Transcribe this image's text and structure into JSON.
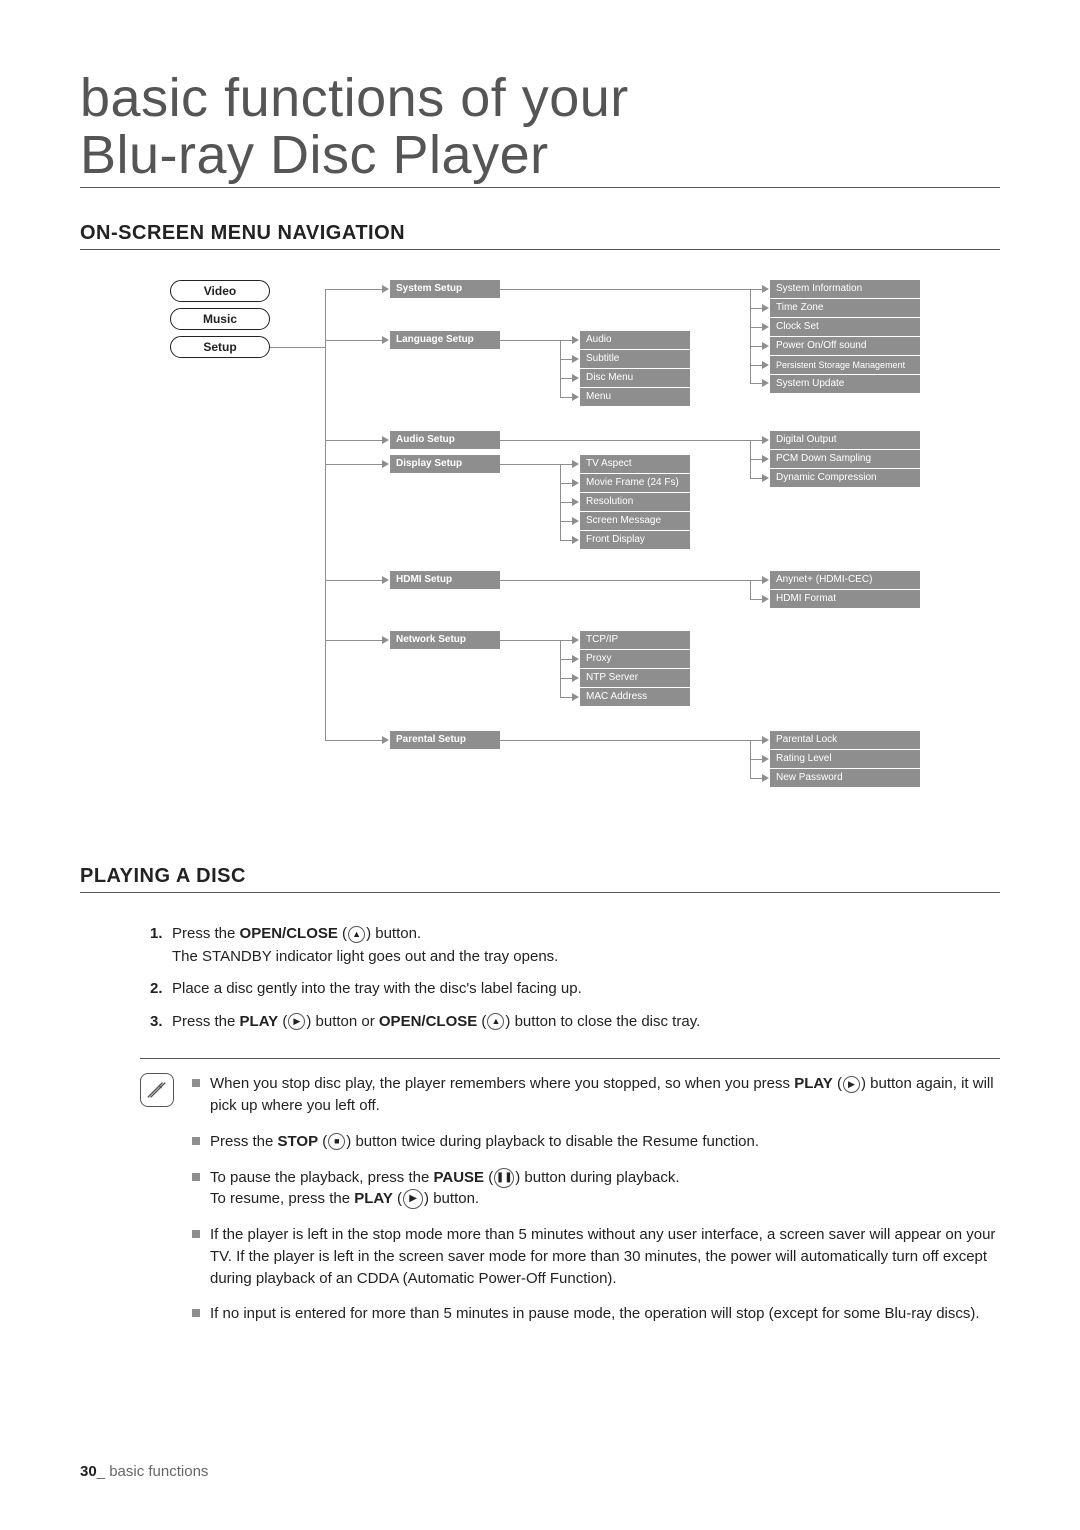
{
  "title": "basic functions of your\nBlu-ray Disc Player",
  "section1": "ON-SCREEN MENU NAVIGATION",
  "section2": "PLAYING A DISC",
  "tabs": {
    "video": "Video",
    "music": "Music",
    "setup": "Setup"
  },
  "col1": {
    "system": "System Setup",
    "language": "Language Setup",
    "audio": "Audio Setup",
    "display": "Display Setup",
    "hdmi": "HDMI Setup",
    "network": "Network Setup",
    "parental": "Parental Setup"
  },
  "lang_sub": {
    "audio": "Audio",
    "subtitle": "Subtitle",
    "discmenu": "Disc Menu",
    "menu": "Menu"
  },
  "disp_sub": {
    "tv": "TV Aspect",
    "movie": "Movie Frame (24 Fs)",
    "res": "Resolution",
    "screen": "Screen Message",
    "front": "Front Display"
  },
  "net_sub": {
    "tcpip": "TCP/IP",
    "proxy": "Proxy",
    "ntp": "NTP Server",
    "mac": "MAC Address"
  },
  "sys_right": {
    "info": "System Information",
    "tz": "Time Zone",
    "clock": "Clock Set",
    "power": "Power On/Off sound",
    "psm": "Persistent Storage Management",
    "update": "System Update"
  },
  "audio_right": {
    "digital": "Digital Output",
    "pcm": "PCM Down Sampling",
    "dyn": "Dynamic Compression"
  },
  "hdmi_right": {
    "anynet": "Anynet+ (HDMI-CEC)",
    "format": "HDMI Format"
  },
  "parental_right": {
    "lock": "Parental Lock",
    "rating": "Rating Level",
    "pwd": "New Password"
  },
  "steps": {
    "s1a": "Press the ",
    "s1b": "OPEN/CLOSE",
    "s1c": " button.",
    "s1d": "The STANDBY indicator light goes out and the tray opens.",
    "s2": "Place a disc gently into the tray with the disc's label facing up.",
    "s3a": "Press the ",
    "s3b": "PLAY",
    "s3c": " button or ",
    "s3d": "OPEN/CLOSE",
    "s3e": " button to close the disc tray."
  },
  "notes": {
    "n1a": "When you stop disc play, the player remembers where you stopped, so when you press ",
    "n1b": "PLAY",
    "n1c": " button again, it will pick up where you left off.",
    "n2a": "Press the ",
    "n2b": "STOP",
    "n2c": " button twice during playback to disable the Resume function.",
    "n3a": "To pause the playback, press the ",
    "n3b": "PAUSE",
    "n3c": " button during playback.",
    "n3d": "To resume, press the ",
    "n3e": "PLAY",
    "n3f": " button.",
    "n4": "If the player is left in the stop mode more than 5 minutes without any user interface, a screen saver will appear on your TV. If the player is left in the screen saver mode for more than 30 minutes, the power will automatically turn off except during playback of an CDDA (Automatic Power-Off Function).",
    "n5": "If no input is entered for more than 5 minutes in pause mode, the operation will stop (except for some Blu-ray discs)."
  },
  "footer": {
    "page": "30",
    "sep": "_ ",
    "label": "basic functions"
  }
}
